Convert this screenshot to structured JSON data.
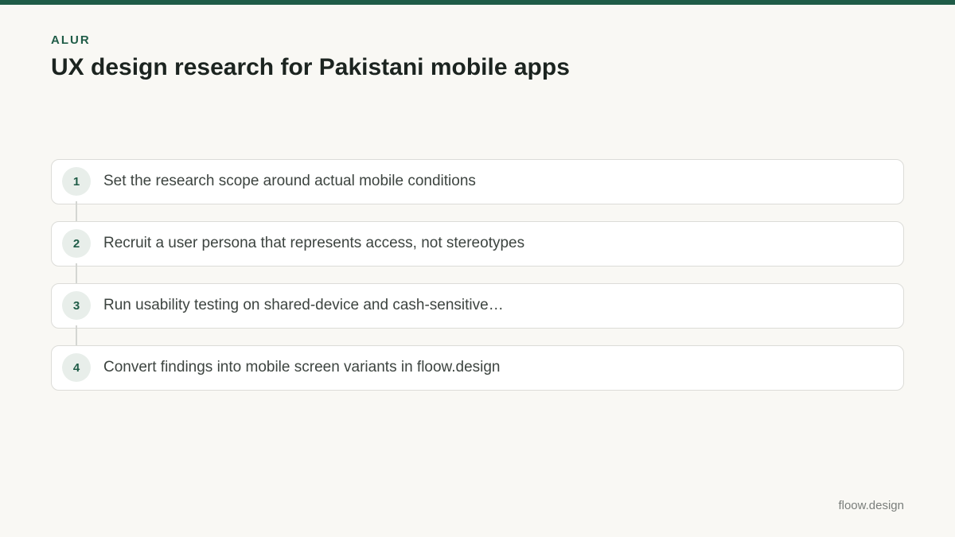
{
  "header": {
    "eyebrow": "ALUR",
    "title": "UX design research for Pakistani mobile apps"
  },
  "steps": [
    {
      "number": "1",
      "text": "Set the research scope around actual mobile conditions"
    },
    {
      "number": "2",
      "text": "Recruit a user persona that represents access, not stereotypes"
    },
    {
      "number": "3",
      "text": "Run usability testing on shared-device and cash-sensitive…"
    },
    {
      "number": "4",
      "text": "Convert findings into mobile screen variants in floow.design"
    }
  ],
  "footer": {
    "brand": "floow.design"
  },
  "colors": {
    "accent": "#1f5c47",
    "background": "#f9f8f4"
  }
}
